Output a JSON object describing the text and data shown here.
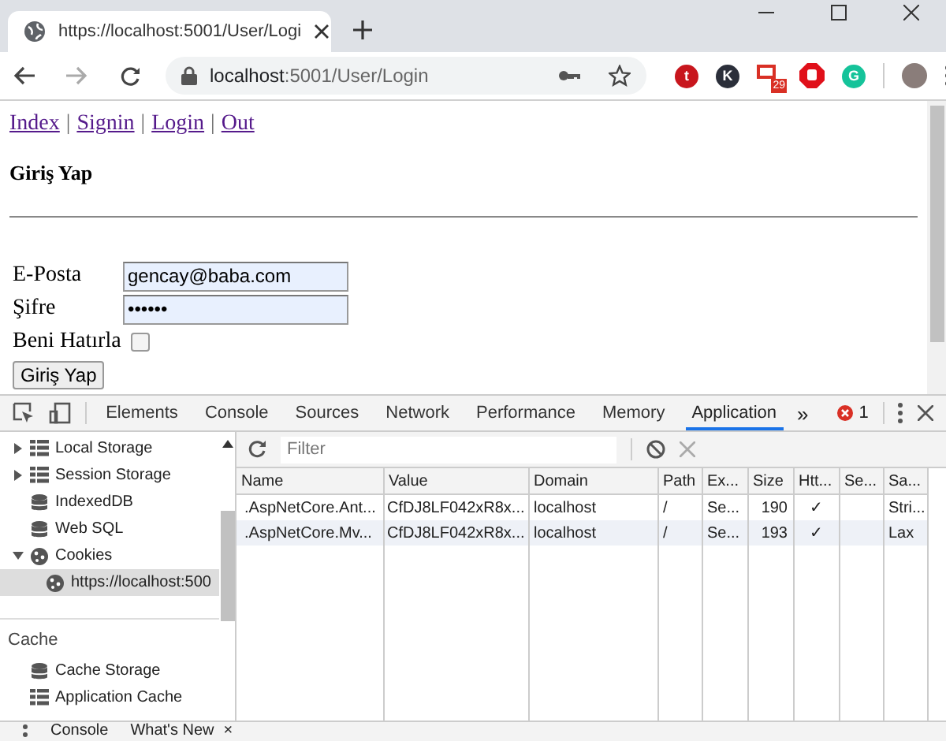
{
  "browser": {
    "tab": {
      "title": "https://localhost:5001/User/Logi"
    },
    "address": {
      "host": "localhost",
      "path": ":5001/User/Login"
    },
    "extensions": [
      {
        "kind": "circle",
        "label": "t",
        "color": "#c8161d"
      },
      {
        "kind": "circle",
        "label": "K",
        "color": "#2b2f3a"
      },
      {
        "kind": "mail",
        "label": "29",
        "color": "#d93025"
      },
      {
        "kind": "stop",
        "color": "#e0101a"
      },
      {
        "kind": "circle",
        "label": "G",
        "color": "#15c39a"
      }
    ]
  },
  "page": {
    "nav": [
      {
        "kind": "link",
        "text": "Index"
      },
      {
        "kind": "separator",
        "text": "|"
      },
      {
        "kind": "link",
        "text": "Signin"
      },
      {
        "kind": "separator",
        "text": "|"
      },
      {
        "kind": "link",
        "text": "Login"
      },
      {
        "kind": "separator",
        "text": "|"
      },
      {
        "kind": "link",
        "text": "Out"
      }
    ],
    "heading": "Giriş Yap",
    "fields": [
      {
        "kind": "text",
        "label": "E-Posta",
        "value": "gencay@baba.com"
      },
      {
        "kind": "text",
        "label": "Şifre",
        "value": "••••••"
      },
      {
        "kind": "checkbox",
        "label": "Beni Hatırla",
        "checked": false
      }
    ],
    "submit": "Giriş Yap"
  },
  "devtools": {
    "tabs": [
      {
        "label": "Elements",
        "selected": false
      },
      {
        "label": "Console",
        "selected": false
      },
      {
        "label": "Sources",
        "selected": false
      },
      {
        "label": "Network",
        "selected": false
      },
      {
        "label": "Performance",
        "selected": false
      },
      {
        "label": "Memory",
        "selected": false
      },
      {
        "label": "Application",
        "selected": true
      }
    ],
    "more": "»",
    "error_count": "1",
    "sidebar": {
      "items": [
        {
          "label": "Local Storage",
          "kind": "grid",
          "expanded": false,
          "selected": false
        },
        {
          "label": "Session Storage",
          "kind": "grid",
          "expanded": false,
          "selected": false
        },
        {
          "label": "IndexedDB",
          "kind": "db",
          "selected": false
        },
        {
          "label": "Web SQL",
          "kind": "db",
          "selected": false
        },
        {
          "label": "Cookies",
          "kind": "cookie",
          "expanded": true,
          "selected": false,
          "children": [
            {
              "label": "https://localhost:500",
              "kind": "cookie",
              "selected": true
            }
          ]
        }
      ],
      "section": "Cache",
      "section_items": [
        {
          "label": "Cache Storage",
          "kind": "db",
          "selected": false
        },
        {
          "label": "Application Cache",
          "kind": "grid",
          "selected": false
        }
      ]
    },
    "filter": {
      "placeholder": "Filter"
    },
    "table": {
      "columns": [
        "Name",
        "Value",
        "Domain",
        "Path",
        "Ex...",
        "Size",
        "Htt...",
        "Se...",
        "Sa..."
      ],
      "rows": [
        {
          "selected": false,
          "cells": [
            ".AspNetCore.Ant...",
            "CfDJ8LF042xR8x...",
            "localhost",
            "/",
            "Se...",
            "190",
            "✓",
            "",
            "Stri..."
          ]
        },
        {
          "selected": true,
          "cells": [
            ".AspNetCore.Mv...",
            "CfDJ8LF042xR8x...",
            "localhost",
            "/",
            "Se...",
            "193",
            "✓",
            "",
            "Lax"
          ]
        }
      ]
    },
    "drawer": {
      "tabs": [
        {
          "label": "Console"
        },
        {
          "label": "What's New"
        }
      ],
      "close": "×"
    }
  }
}
